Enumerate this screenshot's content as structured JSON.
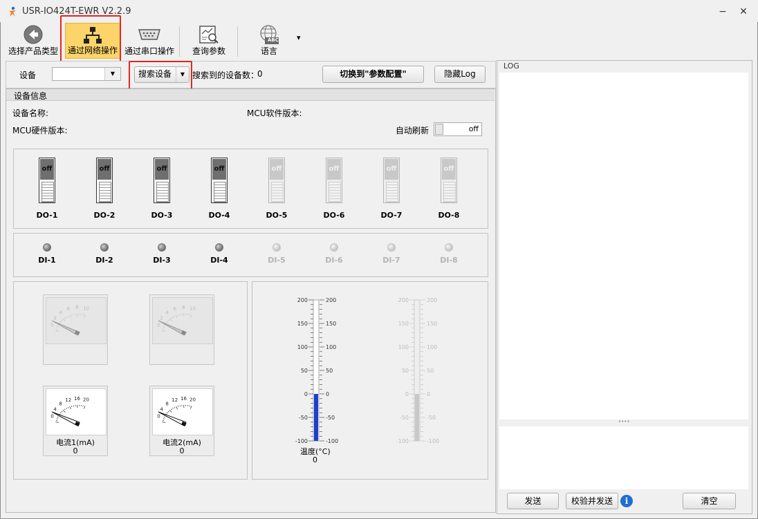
{
  "window": {
    "title": "USR-IO424T-EWR V2.2.9",
    "min": "−",
    "close": "✕"
  },
  "toolbar": {
    "select_type": "选择产品类型",
    "network": "通过网络操作",
    "serial": "通过串口操作",
    "query": "查询参数",
    "language": "语言",
    "language_arrow": "▾",
    "abc": "ABC"
  },
  "top": {
    "device_label": "设备",
    "device_value": "",
    "search_btn": "搜索设备",
    "search_count_label": "搜索到的设备数：",
    "search_count": "0",
    "switch_btn": "切换到\"参数配置\"",
    "hide_log_btn": "隐藏Log"
  },
  "info": {
    "section": "设备信息",
    "device_name_label": "设备名称:",
    "mcu_sw_label": "MCU软件版本:",
    "mcu_hw_label": "MCU硬件版本:",
    "auto_refresh_label": "自动刷新",
    "auto_refresh_state": "off"
  },
  "do_outputs": [
    {
      "label": "DO-1",
      "state": "off",
      "enabled": true
    },
    {
      "label": "DO-2",
      "state": "off",
      "enabled": true
    },
    {
      "label": "DO-3",
      "state": "off",
      "enabled": true
    },
    {
      "label": "DO-4",
      "state": "off",
      "enabled": true
    },
    {
      "label": "DO-5",
      "state": "off",
      "enabled": false
    },
    {
      "label": "DO-6",
      "state": "off",
      "enabled": false
    },
    {
      "label": "DO-7",
      "state": "off",
      "enabled": false
    },
    {
      "label": "DO-8",
      "state": "off",
      "enabled": false
    }
  ],
  "di_inputs": [
    {
      "label": "DI-1",
      "enabled": true
    },
    {
      "label": "DI-2",
      "enabled": true
    },
    {
      "label": "DI-3",
      "enabled": true
    },
    {
      "label": "DI-4",
      "enabled": true
    },
    {
      "label": "DI-5",
      "enabled": false
    },
    {
      "label": "DI-6",
      "enabled": false
    },
    {
      "label": "DI-7",
      "enabled": false
    },
    {
      "label": "DI-8",
      "enabled": false
    }
  ],
  "gauges": {
    "disabled_scale": [
      "0",
      "2",
      "4",
      "6",
      "8",
      "10"
    ],
    "current_scale": [
      "0",
      "4",
      "8",
      "12",
      "16",
      "20"
    ],
    "current1_label": "电流1(mA)",
    "current1_value": "0",
    "current2_label": "电流2(mA)",
    "current2_value": "0"
  },
  "thermometer": {
    "ticks": [
      "200",
      "150",
      "100",
      "50",
      "0",
      "-50",
      "-100"
    ],
    "label": "温度(°C)",
    "value": "0",
    "fill_from": -100,
    "fill_to": 0,
    "range": [
      -100,
      200
    ]
  },
  "log": {
    "title": "LOG",
    "splitter": "••••",
    "send": "发送",
    "verify_send": "校验并发送",
    "info_icon": "i",
    "clear": "清空"
  },
  "colors": {
    "highlight_red": "#e8231e",
    "toolbar_active": "#fbd46a",
    "mercury": "#1d3fd0"
  }
}
